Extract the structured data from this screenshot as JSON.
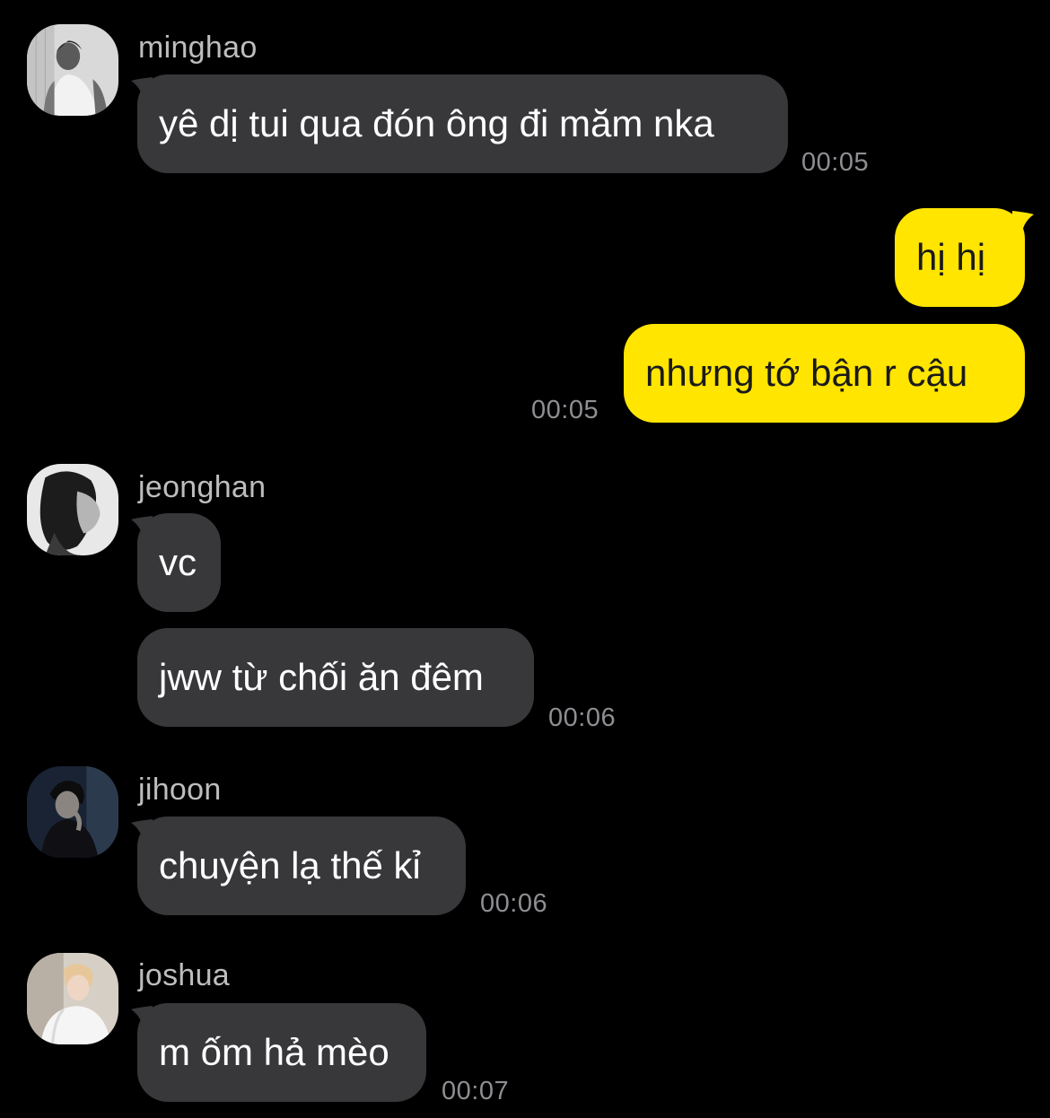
{
  "colors": {
    "background": "#000000",
    "incoming_bubble": "#38383b",
    "outgoing_bubble": "#ffe500",
    "sender_name": "#bdbdbd",
    "timestamp": "#8e8e93"
  },
  "messages": [
    {
      "sender": "minghao",
      "text": "yê dị tui qua đón ông đi măm nka",
      "time": "00:05",
      "direction": "incoming"
    },
    {
      "sender": "",
      "text": "hị hị",
      "time": "",
      "direction": "outgoing"
    },
    {
      "sender": "",
      "text": "nhưng tớ bận r cậu",
      "time": "00:05",
      "direction": "outgoing"
    },
    {
      "sender": "jeonghan",
      "text": "vc",
      "time": "",
      "direction": "incoming"
    },
    {
      "sender": "jeonghan",
      "text": "jww từ chối ăn đêm",
      "time": "00:06",
      "direction": "incoming"
    },
    {
      "sender": "jihoon",
      "text": "chuyện lạ thế kỉ",
      "time": "00:06",
      "direction": "incoming"
    },
    {
      "sender": "joshua",
      "text": "m ốm hả mèo",
      "time": "00:07",
      "direction": "incoming"
    }
  ]
}
